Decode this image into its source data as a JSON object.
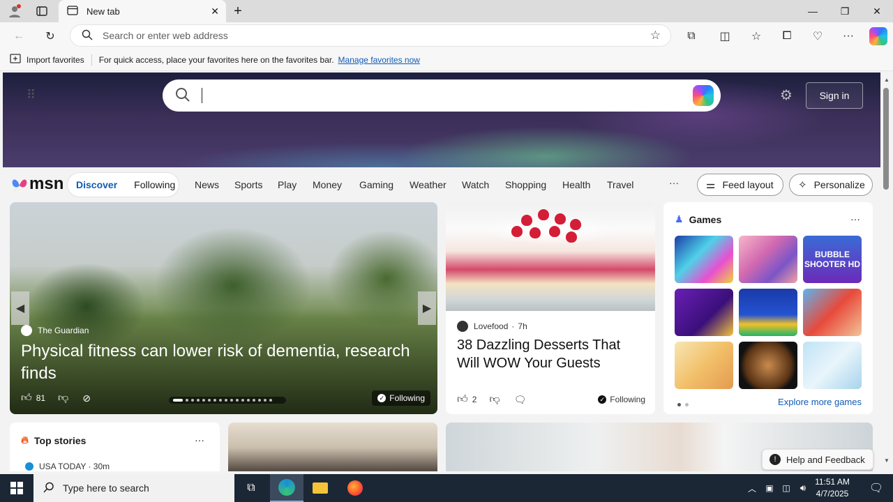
{
  "browser": {
    "tab_title": "New tab",
    "address_placeholder": "Search or enter web address",
    "favorites_bar": {
      "import_label": "Import favorites",
      "message": "For quick access, place your favorites here on the favorites bar.",
      "manage_link": "Manage favorites now"
    }
  },
  "msn": {
    "sign_in": "Sign in",
    "logo_text": "msn",
    "pill_tabs": [
      "Discover",
      "Following"
    ],
    "nav": [
      "News",
      "Sports",
      "Play",
      "Money",
      "Gaming",
      "Weather",
      "Watch",
      "Shopping",
      "Health",
      "Travel"
    ],
    "more": "···",
    "feed_layout": "Feed layout",
    "personalize": "Personalize"
  },
  "hero_story": {
    "source": "The Guardian",
    "headline": "Physical fitness can lower risk of dementia, research finds",
    "likes": "81",
    "following": "Following"
  },
  "dessert_story": {
    "source": "Lovefood",
    "age": "7h",
    "title": "38 Dazzling Desserts That Will WOW Your Guests",
    "likes": "2",
    "following": "Following"
  },
  "games": {
    "title": "Games",
    "more_menu": "···",
    "tile3_text": "BUBBLE SHOOTER HD",
    "explore": "Explore more games"
  },
  "top_stories": {
    "title": "Top stories",
    "more_menu": "···",
    "first_source": "USA TODAY · 30m"
  },
  "help": "Help and Feedback",
  "taskbar": {
    "search_placeholder": "Type here to search",
    "time": "11:51 AM",
    "date": "4/7/2025"
  }
}
